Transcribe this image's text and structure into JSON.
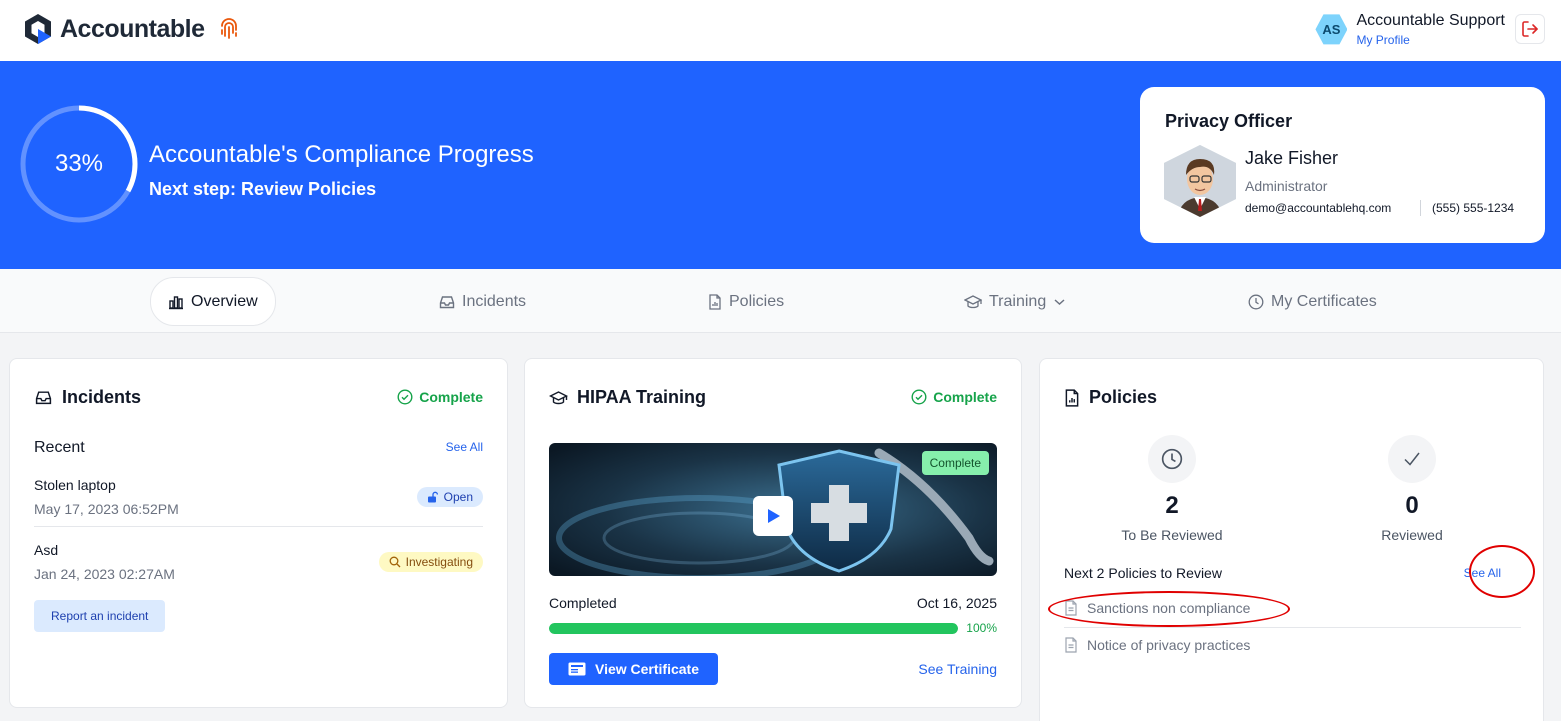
{
  "header": {
    "logo_text": "Accountable",
    "user_initials": "AS",
    "user_name": "Accountable Support",
    "profile_link": "My Profile"
  },
  "hero": {
    "progress_percent": 33,
    "progress_label": "33%",
    "title": "Accountable's Compliance Progress",
    "next_step": "Next step: Review Policies"
  },
  "privacy_officer": {
    "heading": "Privacy Officer",
    "name": "Jake Fisher",
    "role": "Administrator",
    "email": "demo@accountablehq.com",
    "phone": "(555) 555-1234"
  },
  "tabs": [
    {
      "label": "Overview",
      "icon": "chart-icon",
      "active": true
    },
    {
      "label": "Incidents",
      "icon": "inbox-icon"
    },
    {
      "label": "Policies",
      "icon": "document-icon"
    },
    {
      "label": "Training",
      "icon": "graduation-cap-icon",
      "dropdown": true
    },
    {
      "label": "My Certificates",
      "icon": "clock-icon"
    }
  ],
  "incidents_card": {
    "title": "Incidents",
    "status": "Complete",
    "recent_label": "Recent",
    "see_all": "See All",
    "items": [
      {
        "name": "Stolen laptop",
        "date": "May 17, 2023 06:52PM",
        "status": "Open"
      },
      {
        "name": "Asd",
        "date": "Jan 24, 2023 02:27AM",
        "status": "Investigating"
      }
    ],
    "report_button": "Report an incident"
  },
  "training_card": {
    "title": "HIPAA Training",
    "status": "Complete",
    "video_badge": "Complete",
    "completed_label": "Completed",
    "completed_date": "Oct 16, 2025",
    "progress_percent": 100,
    "progress_label": "100%",
    "view_certificate": "View Certificate",
    "see_training": "See Training"
  },
  "policies_card": {
    "title": "Policies",
    "to_be_reviewed_count": "2",
    "to_be_reviewed_label": "To Be Reviewed",
    "reviewed_count": "0",
    "reviewed_label": "Reviewed",
    "next_label": "Next 2 Policies to Review",
    "see_all": "See All",
    "items": [
      "Sanctions non compliance",
      "Notice of privacy practices"
    ]
  },
  "colors": {
    "brand_blue": "#1f63ff",
    "success_green": "#16a34a",
    "annotation_red": "#e00000"
  }
}
